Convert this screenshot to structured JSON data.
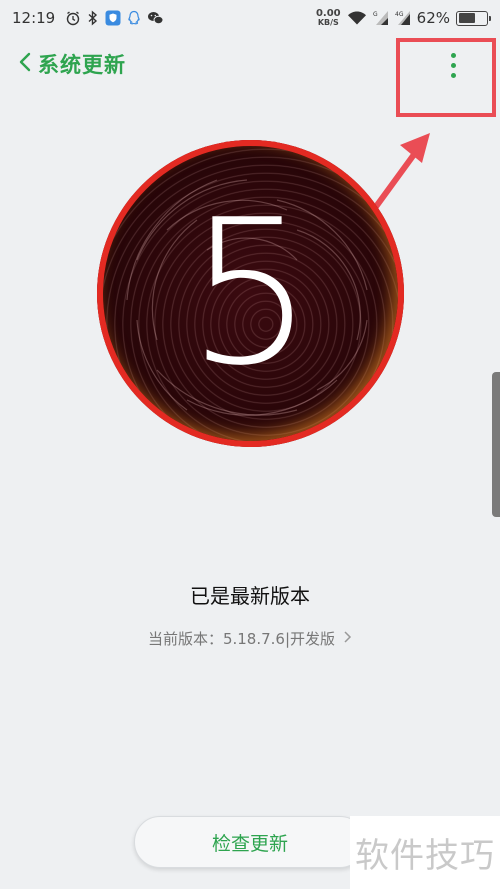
{
  "status_bar": {
    "time": "12:19",
    "net_speed_value": "0.00",
    "net_speed_unit": "KB/S",
    "battery": "62%",
    "battery_level": 0.62
  },
  "header": {
    "title": "系统更新"
  },
  "hero": {
    "digit": "5"
  },
  "main": {
    "status_title": "已是最新版本",
    "version_label": "当前版本：5.18.7.6|开发版"
  },
  "actions": {
    "check_update_label": "检查更新"
  },
  "watermark": {
    "text": "软件技巧"
  },
  "colors": {
    "accent": "#2ea44f",
    "annotation": "#ea4d55",
    "background": "#eef0f2"
  },
  "icons": [
    "alarm-icon",
    "bluetooth-icon",
    "security-icon",
    "qq-icon",
    "wechat-icon",
    "wifi-icon",
    "signal-icon",
    "signal-4g-icon",
    "battery-icon",
    "back-chevron-icon",
    "more-vertical-icon",
    "chevron-right-icon"
  ]
}
